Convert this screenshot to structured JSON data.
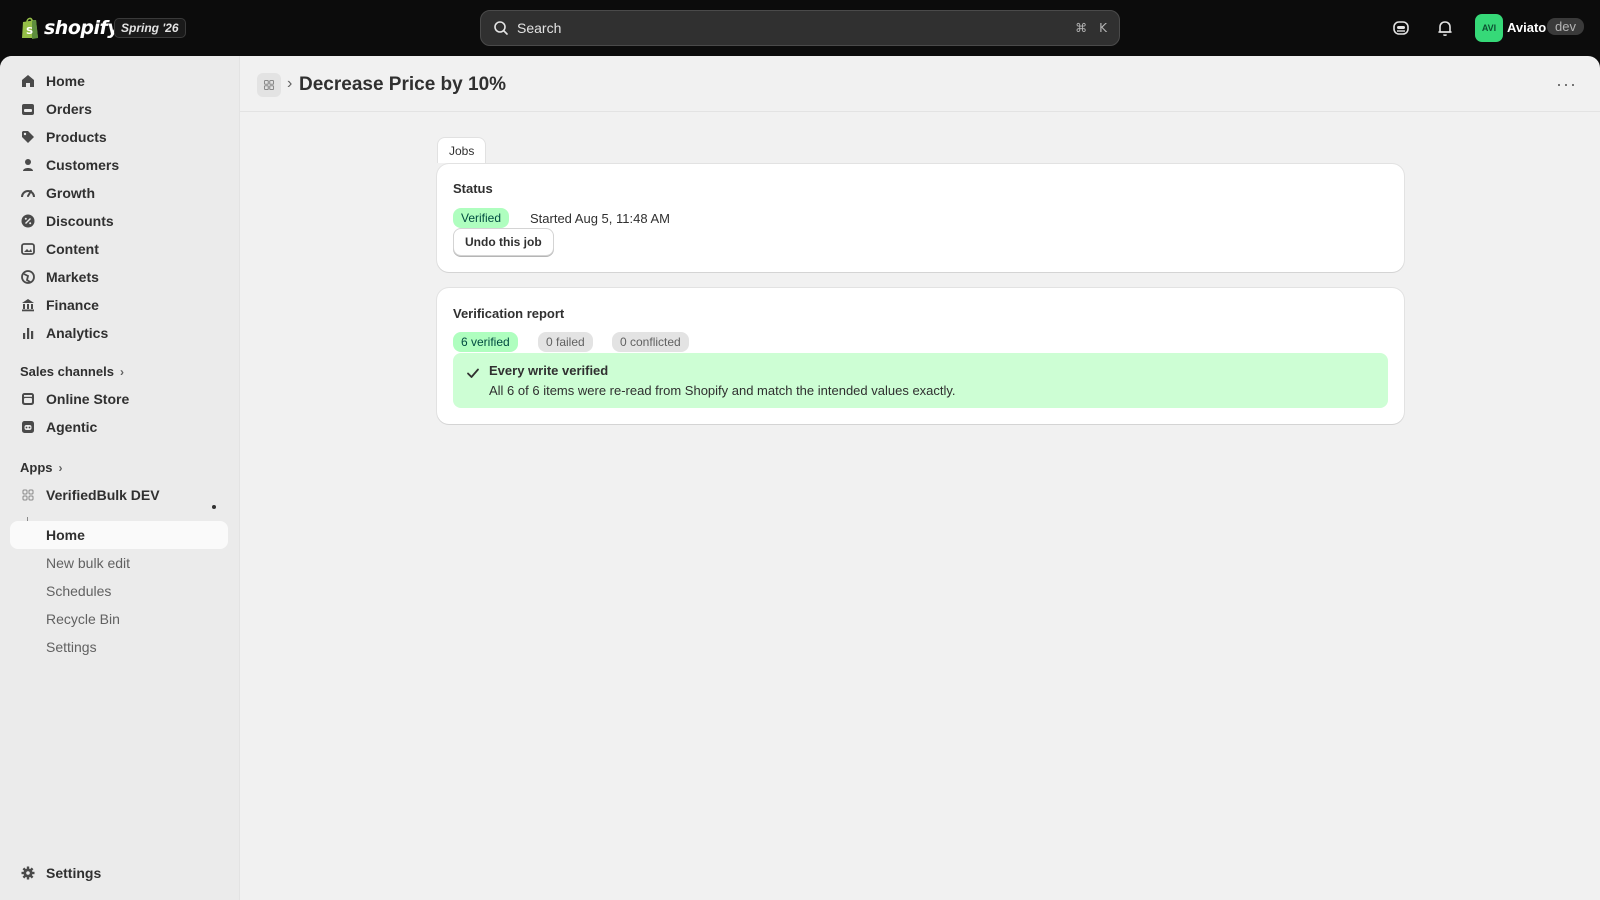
{
  "topbar": {
    "brand": "shopify",
    "edition": "Spring '26",
    "search_placeholder": "Search",
    "shortcut_cmd": "⌘",
    "shortcut_key": "K",
    "avatar_initials": "AVI",
    "store_name": "Aviato",
    "store_tag": "dev"
  },
  "sidebar": {
    "items": [
      {
        "label": "Home",
        "icon": "home-icon"
      },
      {
        "label": "Orders",
        "icon": "orders-icon"
      },
      {
        "label": "Products",
        "icon": "tag-icon"
      },
      {
        "label": "Customers",
        "icon": "person-icon"
      },
      {
        "label": "Growth",
        "icon": "gauge-icon"
      },
      {
        "label": "Discounts",
        "icon": "discount-icon"
      },
      {
        "label": "Content",
        "icon": "image-icon"
      },
      {
        "label": "Markets",
        "icon": "globe-icon"
      },
      {
        "label": "Finance",
        "icon": "bank-icon"
      },
      {
        "label": "Analytics",
        "icon": "chart-icon"
      }
    ],
    "sales_channels_label": "Sales channels",
    "channels": [
      {
        "label": "Online Store",
        "icon": "store-icon"
      },
      {
        "label": "Agentic",
        "icon": "agent-icon"
      }
    ],
    "apps_label": "Apps",
    "app_name": "VerifiedBulk DEV",
    "app_subitems": [
      "Home",
      "New bulk edit",
      "Schedules",
      "Recycle Bin",
      "Settings"
    ],
    "settings_label": "Settings"
  },
  "header": {
    "title": "Decrease Price by 10%",
    "breadcrumb_sep": "›",
    "more": "···"
  },
  "tabs": {
    "jobs": "Jobs"
  },
  "status_card": {
    "title": "Status",
    "badge": "Verified",
    "started": "Started Aug 5, 11:48 AM",
    "undo_label": "Undo this job"
  },
  "report_card": {
    "title": "Verification report",
    "verified": "6 verified",
    "failed": "0 failed",
    "conflicted": "0 conflicted",
    "banner_title": "Every write verified",
    "banner_body": "All 6 of 6 items were re-read from Shopify and match the intended values exactly."
  },
  "colors": {
    "topbar": "#0c0c0c",
    "success_badge": "#affebf",
    "success_banner": "#cdfed4",
    "avatar": "#36d978"
  }
}
